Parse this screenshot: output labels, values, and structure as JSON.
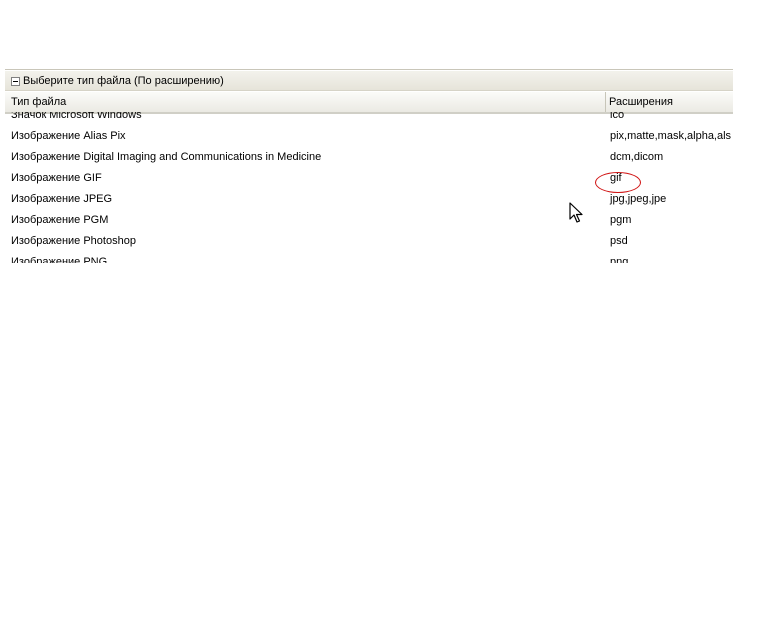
{
  "section": {
    "title": "Выберите тип файла (По расширению)"
  },
  "table": {
    "columns": [
      "Тип файла",
      "Расширения"
    ],
    "rows": [
      {
        "type": "Значок Microsoft Windows",
        "ext": "ico"
      },
      {
        "type": "Изображение Alias Pix",
        "ext": "pix,matte,mask,alpha,als"
      },
      {
        "type": "Изображение Digital Imaging and Communications in Medicine",
        "ext": "dcm,dicom"
      },
      {
        "type": "Изображение GIF",
        "ext": "gif"
      },
      {
        "type": "Изображение JPEG",
        "ext": "jpg,jpeg,jpe"
      },
      {
        "type": "Изображение PGM",
        "ext": "pgm"
      },
      {
        "type": "Изображение Photoshop",
        "ext": "psd"
      },
      {
        "type": "Изображение PNG",
        "ext": "png"
      }
    ]
  },
  "annotation": {
    "color": "#d01010"
  }
}
